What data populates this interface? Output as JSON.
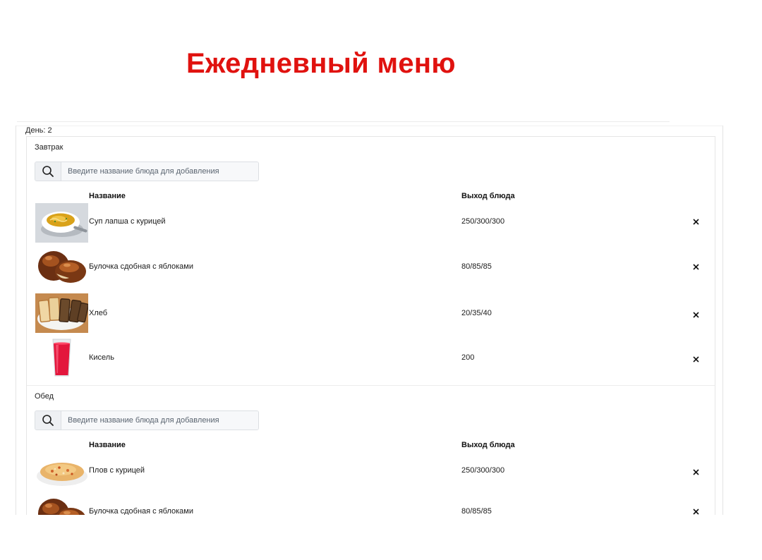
{
  "page": {
    "title": "Ежедневный меню"
  },
  "day": {
    "label": "День: 2"
  },
  "columns": {
    "name": "Название",
    "yield": "Выход блюда"
  },
  "search": {
    "placeholder": "Введите название блюда для добавления"
  },
  "colors": {
    "title": "#e0120f",
    "text": "#1a1a1a",
    "border": "#e6e6e6"
  },
  "meals": [
    {
      "name": "Завтрак",
      "dishes": [
        {
          "name": "Суп лапша с курицей",
          "yield": "250/300/300",
          "icon": "soup-bowl-image"
        },
        {
          "name": "Булочка сдобная с яблоками",
          "yield": "80/85/85",
          "icon": "bun-image"
        },
        {
          "name": "Хлеб",
          "yield": "20/35/40",
          "icon": "bread-image"
        },
        {
          "name": "Кисель",
          "yield": "200",
          "icon": "drink-glass-image"
        }
      ]
    },
    {
      "name": "Обед",
      "dishes": [
        {
          "name": "Плов с курицей",
          "yield": "250/300/300",
          "icon": "pilaf-plate-image"
        },
        {
          "name": "Булочка сдобная с яблоками",
          "yield": "80/85/85",
          "icon": "bun-image"
        }
      ]
    }
  ],
  "icons": {
    "search": "search-icon",
    "remove": "close-icon"
  }
}
